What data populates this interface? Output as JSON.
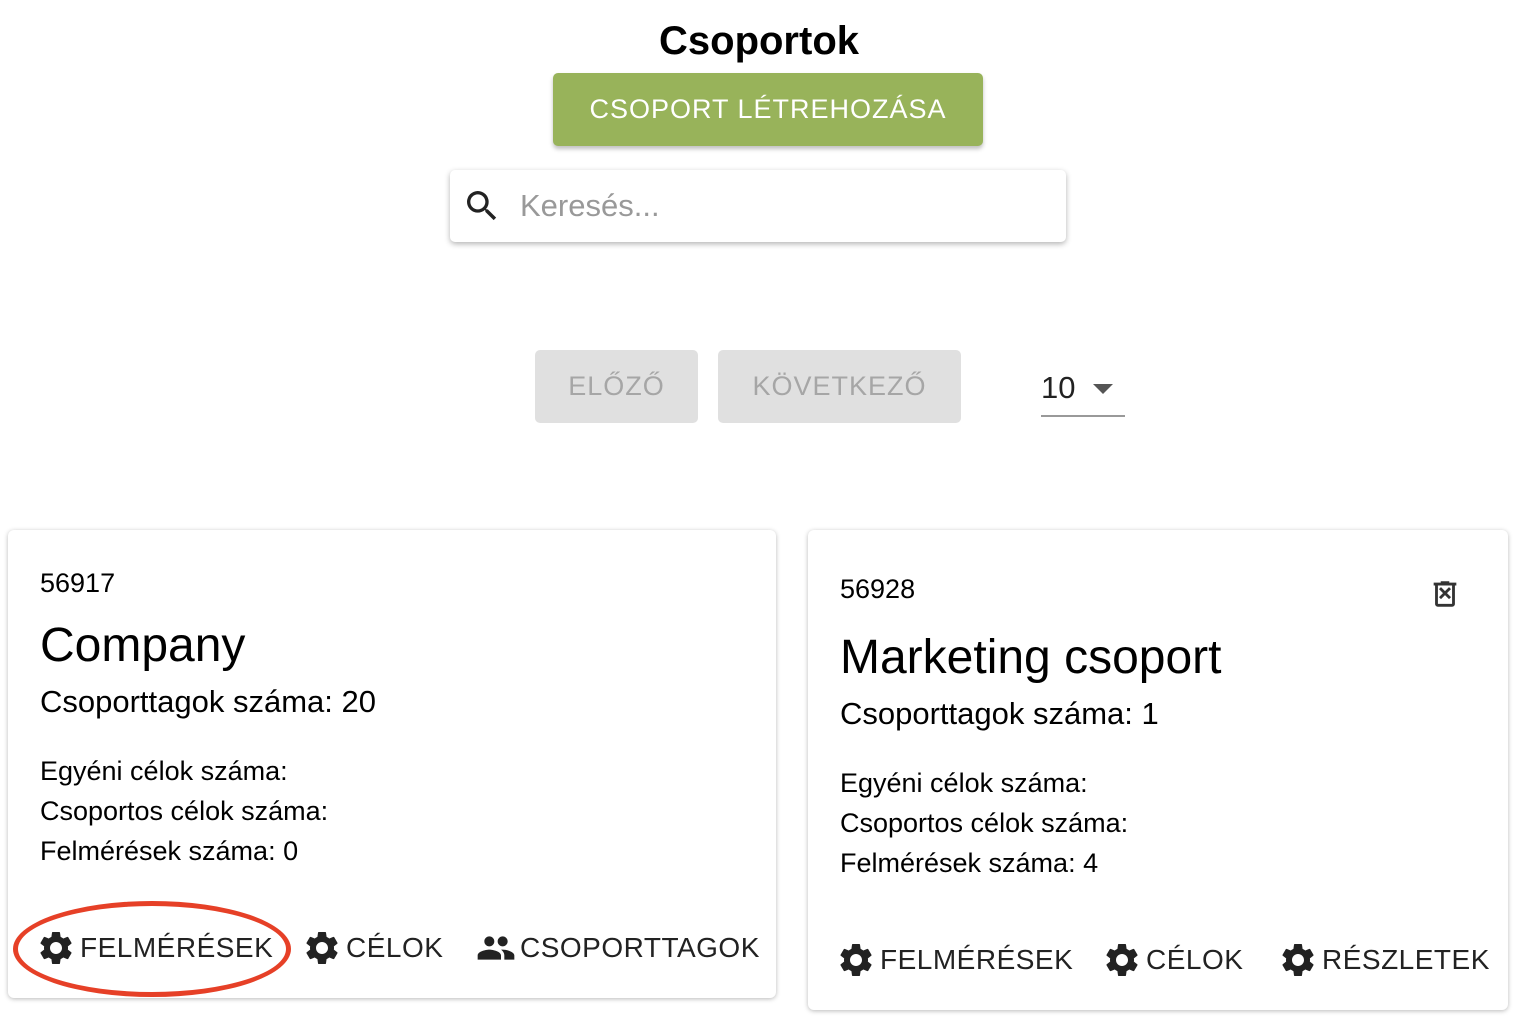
{
  "page": {
    "title": "Csoportok",
    "create_button_label": "CSOPORT LÉTREHOZÁSA",
    "accent_color": "#98b35a",
    "highlight_color": "#e64027"
  },
  "search": {
    "placeholder": "Keresés...",
    "value": ""
  },
  "pagination": {
    "prev_label": "ELŐZŐ",
    "next_label": "KÖVETKEZŐ",
    "page_size": "10"
  },
  "groups": [
    {
      "id": "56917",
      "name": "Company",
      "members": "Csoporttagok száma: 20",
      "individual_goals": "Egyéni célok száma:",
      "group_goals": "Csoportos célok száma:",
      "surveys": "Felmérések száma: 0",
      "actions": [
        {
          "label": "FELMÉRÉSEK",
          "icon": "gear-icon"
        },
        {
          "label": "CÉLOK",
          "icon": "gear-icon"
        },
        {
          "label": "CSOPORTTAGOK",
          "icon": "people-icon"
        }
      ],
      "highlighted_action": "FELMÉRÉSEK"
    },
    {
      "id": "56928",
      "name": "Marketing csoport",
      "members": "Csoporttagok száma: 1",
      "individual_goals": "Egyéni célok száma:",
      "group_goals": "Csoportos célok száma:",
      "surveys": "Felmérések száma: 4",
      "delete_icon": "trash-icon",
      "actions": [
        {
          "label": "FELMÉRÉSEK",
          "icon": "gear-icon"
        },
        {
          "label": "CÉLOK",
          "icon": "gear-icon"
        },
        {
          "label": "RÉSZLETEK",
          "icon": "gear-icon"
        }
      ]
    }
  ]
}
